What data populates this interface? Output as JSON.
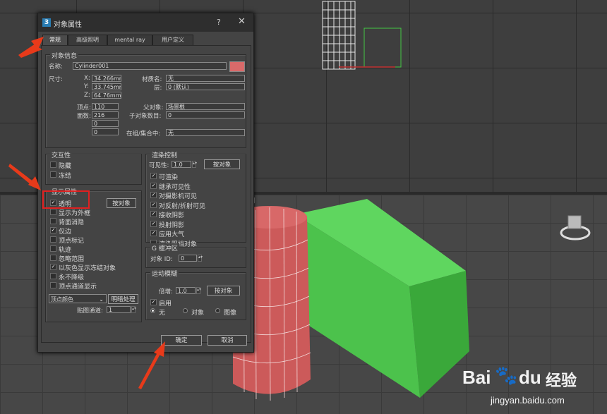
{
  "dialog": {
    "title": "对象属性",
    "help": "?",
    "close": "✕",
    "tabs": [
      "常规",
      "高级照明",
      "mental ray",
      "用户定义"
    ]
  },
  "object_info": {
    "group_label": "对象信息",
    "name_label": "名称:",
    "name_value": "Cylinder001",
    "dimensions_label": "尺寸:",
    "x_label": "X:",
    "x_value": "34.266mm",
    "y_label": "Y:",
    "y_value": "33.745mm",
    "z_label": "Z:",
    "z_value": "64.76mm",
    "material_label": "材质名:",
    "material_value": "无",
    "layer_label": "层:",
    "layer_value": "0 (默认)",
    "vertices_label": "顶点:",
    "vertices_value": "110",
    "faces_label": "面数:",
    "faces_value": "216",
    "extra1_value": "0",
    "extra2_value": "0",
    "parent_label": "父对象:",
    "parent_value": "场景根",
    "children_label": "子对象数目:",
    "children_value": "0",
    "group_in_label": "在组/集合中:",
    "group_in_value": "无"
  },
  "interactivity": {
    "group_label": "交互性",
    "hide_label": "隐藏",
    "freeze_label": "冻结"
  },
  "display_props": {
    "group_label": "显示属性",
    "by_object_button": "按对象",
    "items": [
      {
        "label": "透明",
        "checked": true
      },
      {
        "label": "显示为外框",
        "checked": false
      },
      {
        "label": "背面消隐",
        "checked": false
      },
      {
        "label": "仅边",
        "checked": true
      },
      {
        "label": "顶点标记",
        "checked": false
      },
      {
        "label": "轨迹",
        "checked": false
      },
      {
        "label": "忽略范围",
        "checked": false
      },
      {
        "label": "以灰色显示冻结对象",
        "checked": true
      },
      {
        "label": "永不降级",
        "checked": false
      },
      {
        "label": "顶点通道显示",
        "checked": false
      }
    ],
    "vertex_color_select": "顶点颜色",
    "shaded_button": "明暗处理",
    "map_channel_label": "贴图通道:",
    "map_channel_value": "1"
  },
  "render_control": {
    "group_label": "渲染控制",
    "visibility_label": "可见性:",
    "visibility_value": "1.0",
    "by_object_button": "按对象",
    "items": [
      {
        "label": "可渲染",
        "checked": true
      },
      {
        "label": "继承可见性",
        "checked": true
      },
      {
        "label": "对摄影机可见",
        "checked": true
      },
      {
        "label": "对反射/折射可见",
        "checked": true
      },
      {
        "label": "接收阴影",
        "checked": true
      },
      {
        "label": "投射阴影",
        "checked": true
      },
      {
        "label": "应用大气",
        "checked": true
      },
      {
        "label": "渲染阻挡对象",
        "checked": false
      }
    ]
  },
  "gbuffer": {
    "group_label": "G 缓冲区",
    "object_id_label": "对象 ID:",
    "object_id_value": "0"
  },
  "motion_blur": {
    "group_label": "运动模糊",
    "multiplier_label": "倍增:",
    "multiplier_value": "1.0",
    "by_object_button": "按对象",
    "enable_label": "启用",
    "radio_none": "无",
    "radio_object": "对象",
    "radio_image": "图像"
  },
  "footer": {
    "ok_button": "确定",
    "cancel_button": "取消"
  },
  "viewport": {
    "persp_label": "[ ]"
  },
  "watermark": {
    "brand": "Bai",
    "brand2": "du",
    "brand_cn": "经验",
    "url": "jingyan.baidu.com"
  },
  "colors": {
    "accent_red": "#e02020",
    "swatch": "#d96a6a",
    "box_green": "#44c844",
    "cylinder_red": "#cc5a5a"
  }
}
